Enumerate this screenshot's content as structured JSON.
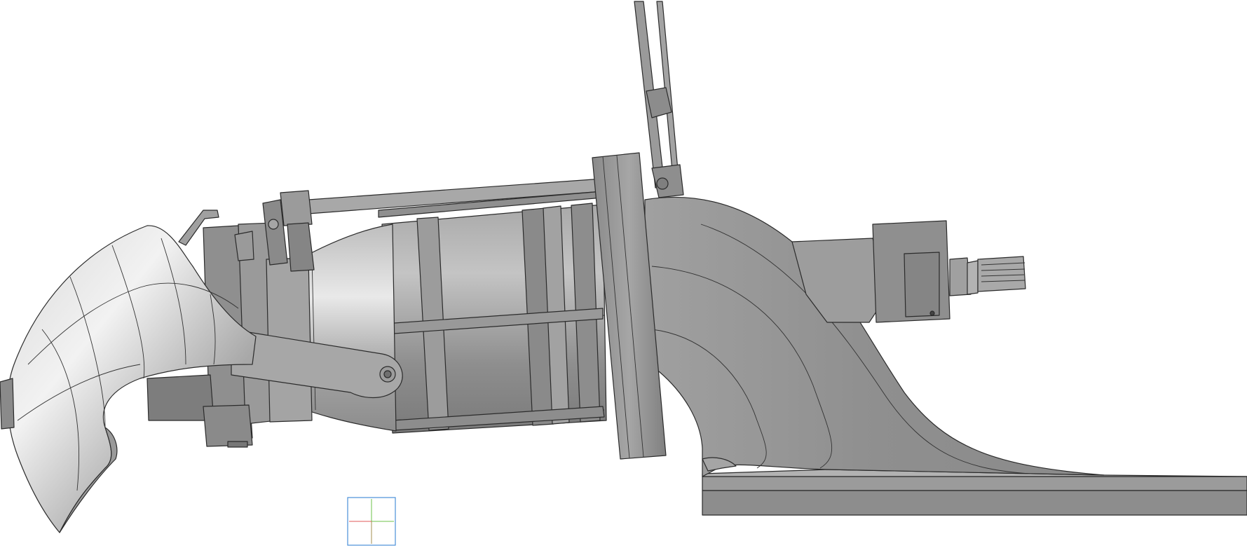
{
  "viewport": {
    "background": "#ffffff",
    "model": "jet-pump-assembly",
    "colors": {
      "body": "#9a9a9a",
      "body_dark": "#7c7c7c",
      "body_light": "#c9c9c9",
      "highlight": "#e6e6e6",
      "edge": "#2b2b2b",
      "triad_box": "#4a90d9",
      "triad_x": "#e05a5a",
      "triad_y": "#6cc04a",
      "triad_z": "#4a90d9"
    }
  }
}
